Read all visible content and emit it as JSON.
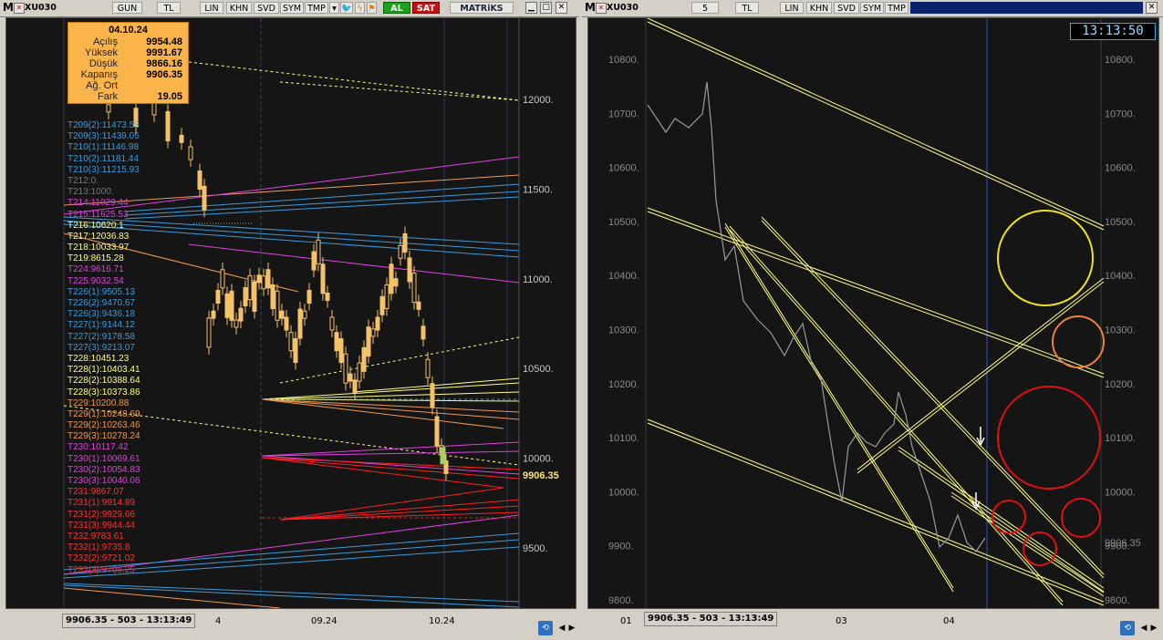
{
  "left_window": {
    "symbol": "XU030",
    "toolbar": [
      "GUN",
      "TL",
      "LIN",
      "KHN",
      "SVD",
      "SYM",
      "TMP",
      "AL",
      "SAT",
      "MATRiKS"
    ],
    "info": {
      "date": "04.10.24",
      "rows": [
        {
          "label": "Açılış",
          "value": "9954.48"
        },
        {
          "label": "Yüksek",
          "value": "9991.67"
        },
        {
          "label": "Düşük",
          "value": "9866.16"
        },
        {
          "label": "Kapanış",
          "value": "9906.35"
        },
        {
          "label": "Ağ. Ort",
          "value": ""
        },
        {
          "label": "Fark",
          "value": "19.05"
        }
      ]
    },
    "y_ticks": [
      "12000.",
      "11500.",
      "11000.",
      "10500.",
      "10000.",
      "9500."
    ],
    "last_price_label": "9906.35",
    "x_ticks": [
      "4",
      "09.24",
      "10.24"
    ],
    "status": "9906.35 - 503 - 13:13:49",
    "targets": [
      {
        "text": "T209(2):11473.53",
        "color": "#3a9bdc"
      },
      {
        "text": "T209(3):11439.05",
        "color": "#3a9bdc"
      },
      {
        "text": "T210(1):11146.98",
        "color": "#3a9bdc"
      },
      {
        "text": "T210(2):11181.44",
        "color": "#3a9bdc"
      },
      {
        "text": "T210(3):11215.93",
        "color": "#3a9bdc"
      },
      {
        "text": "T212:0.",
        "color": "#777777"
      },
      {
        "text": "T213:1000.",
        "color": "#777777"
      },
      {
        "text": "T214:11029.44",
        "color": "#e040e0"
      },
      {
        "text": "T215:11625.53",
        "color": "#e040e0"
      },
      {
        "text": "T216:10620.1",
        "color": "#ffff80"
      },
      {
        "text": "T217:12036.83",
        "color": "#ffff80"
      },
      {
        "text": "T218:10033.97",
        "color": "#ffff80"
      },
      {
        "text": "T219:8615.28",
        "color": "#ffff80"
      },
      {
        "text": "T224:9616.71",
        "color": "#e040e0"
      },
      {
        "text": "T225:9032.54",
        "color": "#e040e0"
      },
      {
        "text": "T226(1):9505.13",
        "color": "#3a9bdc"
      },
      {
        "text": "T226(2):9470.67",
        "color": "#3a9bdc"
      },
      {
        "text": "T226(3):9436.18",
        "color": "#3a9bdc"
      },
      {
        "text": "T227(1):9144.12",
        "color": "#3a9bdc"
      },
      {
        "text": "T227(2):9178.58",
        "color": "#3a9bdc"
      },
      {
        "text": "T227(3):9213.07",
        "color": "#3a9bdc"
      },
      {
        "text": "T228:10451.23",
        "color": "#ffff80"
      },
      {
        "text": "T228(1):10403.41",
        "color": "#ffff80"
      },
      {
        "text": "T228(2):10388.64",
        "color": "#ffff80"
      },
      {
        "text": "T228(3):10373.86",
        "color": "#ffff80"
      },
      {
        "text": "T229:10200.88",
        "color": "#f09a50"
      },
      {
        "text": "T229(1):10248.69",
        "color": "#f09a50"
      },
      {
        "text": "T229(2):10263.46",
        "color": "#f09a50"
      },
      {
        "text": "T229(3):10278.24",
        "color": "#f09a50"
      },
      {
        "text": "T230:10117.42",
        "color": "#e040e0"
      },
      {
        "text": "T230(1):10069.61",
        "color": "#e040e0"
      },
      {
        "text": "T230(2):10054.83",
        "color": "#e040e0"
      },
      {
        "text": "T230(3):10040.06",
        "color": "#e040e0"
      },
      {
        "text": "T231:9867.07",
        "color": "#ff3030"
      },
      {
        "text": "T231(1):9914.89",
        "color": "#ff3030"
      },
      {
        "text": "T231(2):9929.66",
        "color": "#ff3030"
      },
      {
        "text": "T231(3):9944.44",
        "color": "#ff3030"
      },
      {
        "text": "T232:9783.61",
        "color": "#ff3030"
      },
      {
        "text": "T232(1):9735.8",
        "color": "#ff3030"
      },
      {
        "text": "T232(2):9721.02",
        "color": "#ff3030"
      },
      {
        "text": "T232(3):9706.25",
        "color": "#ff3030"
      }
    ]
  },
  "right_window": {
    "symbol": "XU030",
    "toolbar": [
      "5",
      "TL",
      "LIN",
      "KHN",
      "SVD",
      "SYM",
      "TMP"
    ],
    "clock": "13:13:50",
    "y_ticks": [
      "10800.",
      "10700.",
      "10600.",
      "10500.",
      "10400.",
      "10300.",
      "10200.",
      "10100.",
      "10000.",
      "9900.",
      "9800."
    ],
    "last_price_label": "9906.35",
    "x_ticks": [
      "01",
      "03",
      "04"
    ],
    "status": "9906.35 - 503 - 13:13:49"
  },
  "colors": {
    "background": "#151515",
    "candle": "#f5c268",
    "yellow_line": "#ffff80",
    "magenta_line": "#e040e0",
    "blue_line": "#3a9bdc",
    "red_line": "#ff2020",
    "orange_line": "#f09a50"
  },
  "icons": [
    "menu-m-icon",
    "close-icon",
    "twitter-icon",
    "bolt-icon",
    "refresh-icon",
    "dropdown-icon",
    "arrow-left-icon",
    "arrow-right-icon"
  ]
}
